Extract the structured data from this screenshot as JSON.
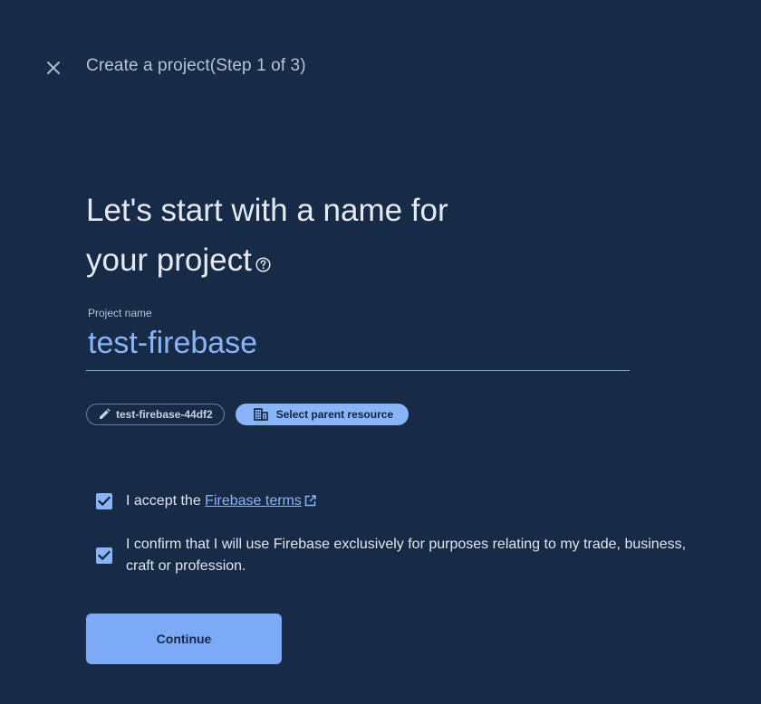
{
  "header": {
    "title": "Create a project(Step 1 of 3)"
  },
  "main": {
    "heading_line1": "Let's start with a name for",
    "heading_line2": "your project",
    "project_name_label": "Project name",
    "project_name_value": "test-firebase",
    "project_id_chip": "test-firebase-44df2",
    "parent_resource_chip": "Select parent resource",
    "terms": {
      "prefix": "I accept the ",
      "link": "Firebase terms",
      "checked": true
    },
    "confirm": {
      "text": "I confirm that I will use Firebase exclusively for purposes relating to my trade, business, craft or profession.",
      "checked": true
    },
    "continue_label": "Continue"
  },
  "colors": {
    "background": "#172a46",
    "accent": "#8ab4f8",
    "button": "#7caaf6"
  },
  "icons": {
    "close": "close-icon",
    "help": "help-icon",
    "edit": "pencil-icon",
    "parent": "building-icon",
    "external": "external-link-icon",
    "check": "check-icon"
  }
}
